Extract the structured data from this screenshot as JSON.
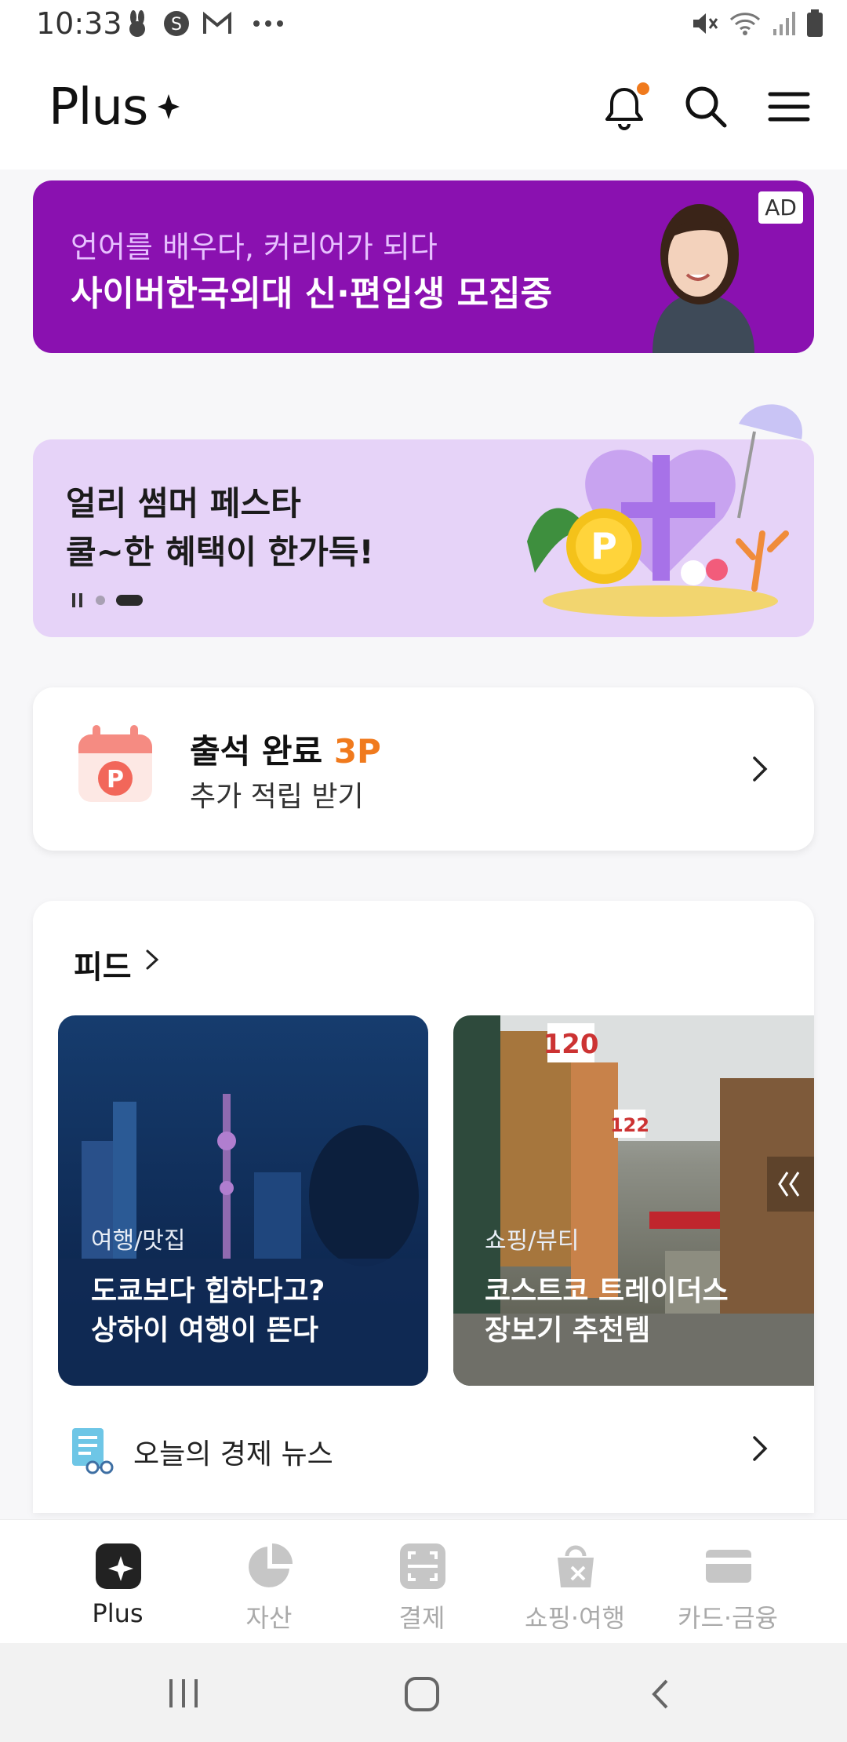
{
  "status": {
    "time": "10:33"
  },
  "header": {
    "logo": "Plus"
  },
  "ad": {
    "subtitle": "언어를 배우다, 커리어가 되다",
    "title": "사이버한국외대 신·편입생 모집중",
    "badge": "AD"
  },
  "promo": {
    "line1": "얼리 썸머 페스타",
    "line2": "쿨~한 혜택이 한가득!"
  },
  "attendance": {
    "title": "출석 완료",
    "points": "3P",
    "subtitle": "추가 적립 받기"
  },
  "feed": {
    "title": "피드",
    "cards": [
      {
        "category": "여행/맛집",
        "line1": "도쿄보다 힙하다고?",
        "line2": "상하이 여행이 뜬다"
      },
      {
        "category": "쇼핑/뷰티",
        "line1": "코스트코 트레이더스",
        "line2": "장보기 추천템"
      }
    ],
    "news": "오늘의 경제 뉴스"
  },
  "bottom_nav": [
    {
      "label": "Plus",
      "icon": "plus-sparkle-icon",
      "active": true
    },
    {
      "label": "자산",
      "icon": "pie-chart-icon",
      "active": false
    },
    {
      "label": "결제",
      "icon": "scan-icon",
      "active": false
    },
    {
      "label": "쇼핑·여행",
      "icon": "shopping-bag-icon",
      "active": false
    },
    {
      "label": "카드·금융",
      "icon": "card-icon",
      "active": false
    }
  ],
  "colors": {
    "accent": "#f07a1d",
    "ad_bg": "#8a11b0",
    "promo_bg": "#e6d3f8"
  }
}
